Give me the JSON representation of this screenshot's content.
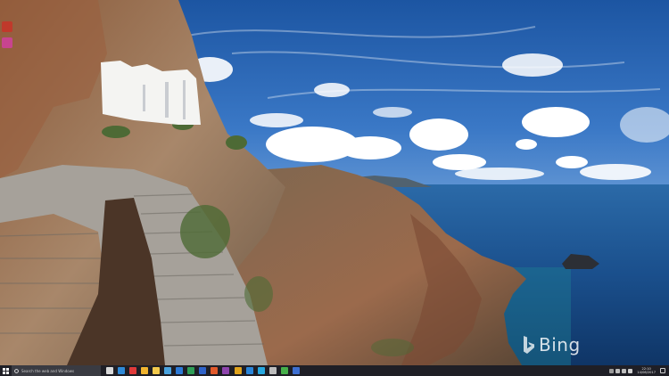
{
  "wallpaper": {
    "subject": "cliffside monastery above the sea",
    "watermark": "Bing"
  },
  "colors": {
    "sky_top": "#1f5aa6",
    "sky_bottom": "#b9d4ee",
    "sea": "#1a4d86",
    "cliff": "#9a7a5c",
    "taskbar": "#1f1f26"
  },
  "desktop": {
    "icons": [
      {
        "name": "desktop-app-icon",
        "color": "#c0392b"
      },
      {
        "name": "desktop-app-icon",
        "color": "#c8448f"
      }
    ]
  },
  "taskbar": {
    "search_placeholder": "Search the web and Windows",
    "apps": [
      {
        "name": "task-view-icon",
        "color": "#d9d9d9"
      },
      {
        "name": "edge-icon",
        "color": "#2f8ad8"
      },
      {
        "name": "opera-icon",
        "color": "#e03a3a"
      },
      {
        "name": "chrome-icon",
        "color": "#f1b42f"
      },
      {
        "name": "file-explorer-icon",
        "color": "#f2c94c"
      },
      {
        "name": "store-icon",
        "color": "#4aa3df"
      },
      {
        "name": "mail-icon",
        "color": "#2d7ad6"
      },
      {
        "name": "excel-icon",
        "color": "#2f9e57"
      },
      {
        "name": "word-icon",
        "color": "#2f63c9"
      },
      {
        "name": "powerpoint-icon",
        "color": "#e25a2b"
      },
      {
        "name": "onenote-icon",
        "color": "#8e44ad"
      },
      {
        "name": "paint-icon",
        "color": "#e0a31c"
      },
      {
        "name": "photos-icon",
        "color": "#2a85d9"
      },
      {
        "name": "skype-icon",
        "color": "#27a8e0"
      },
      {
        "name": "settings-icon",
        "color": "#bdbdbd"
      },
      {
        "name": "checkmark-icon",
        "color": "#46b04a"
      },
      {
        "name": "app-icon",
        "color": "#3d6fd1"
      }
    ],
    "clock": {
      "time": "22:10",
      "date": "14/08/2017"
    }
  }
}
